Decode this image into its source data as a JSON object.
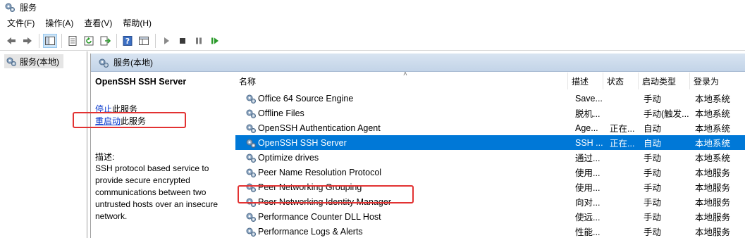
{
  "window": {
    "title": "服务"
  },
  "menu": [
    "文件(F)",
    "操作(A)",
    "查看(V)",
    "帮助(H)"
  ],
  "toolbar": [
    "back-icon",
    "forward-icon",
    "show-hide-tree-icon",
    "properties-icon",
    "refresh-icon",
    "export-list-icon",
    "help-icon",
    "view-icon",
    "start-service-icon",
    "stop-service-icon",
    "pause-service-icon",
    "resume-service-icon"
  ],
  "tree": {
    "root_label": "服务(本地)"
  },
  "panel": {
    "header": "服务(本地)",
    "service_title": "OpenSSH SSH Server",
    "stop_link": "停止",
    "stop_suffix": "此服务",
    "restart_link": "重启动",
    "restart_suffix": "此服务",
    "desc_label": "描述:",
    "description": "SSH protocol based service to provide secure encrypted communications between two untrusted hosts over an insecure network."
  },
  "columns": {
    "name": "名称",
    "desc": "描述",
    "status": "状态",
    "startup": "启动类型",
    "logon": "登录为"
  },
  "rows": [
    {
      "name": "Office 64 Source Engine",
      "desc": "Save...",
      "status": "",
      "startup": "手动",
      "logon": "本地系统"
    },
    {
      "name": "Offline Files",
      "desc": "脱机...",
      "status": "",
      "startup": "手动(触发...",
      "logon": "本地系统"
    },
    {
      "name": "OpenSSH Authentication Agent",
      "desc": "Age...",
      "status": "正在...",
      "startup": "自动",
      "logon": "本地系统"
    },
    {
      "name": "OpenSSH SSH Server",
      "desc": "SSH ...",
      "status": "正在...",
      "startup": "自动",
      "logon": "本地系统"
    },
    {
      "name": "Optimize drives",
      "desc": "通过...",
      "status": "",
      "startup": "手动",
      "logon": "本地系统"
    },
    {
      "name": "Peer Name Resolution Protocol",
      "desc": "使用...",
      "status": "",
      "startup": "手动",
      "logon": "本地服务"
    },
    {
      "name": "Peer Networking Grouping",
      "desc": "使用...",
      "status": "",
      "startup": "手动",
      "logon": "本地服务"
    },
    {
      "name": "Peer Networking Identity Manager",
      "desc": "向对...",
      "status": "",
      "startup": "手动",
      "logon": "本地服务"
    },
    {
      "name": "Performance Counter DLL Host",
      "desc": "使远...",
      "status": "",
      "startup": "手动",
      "logon": "本地服务"
    },
    {
      "name": "Performance Logs & Alerts",
      "desc": "性能...",
      "status": "",
      "startup": "手动",
      "logon": "本地服务"
    }
  ],
  "selected_row": 3,
  "colors": {
    "selection": "#0078d7",
    "highlight_box": "#e23232",
    "link": "#0033cc"
  }
}
